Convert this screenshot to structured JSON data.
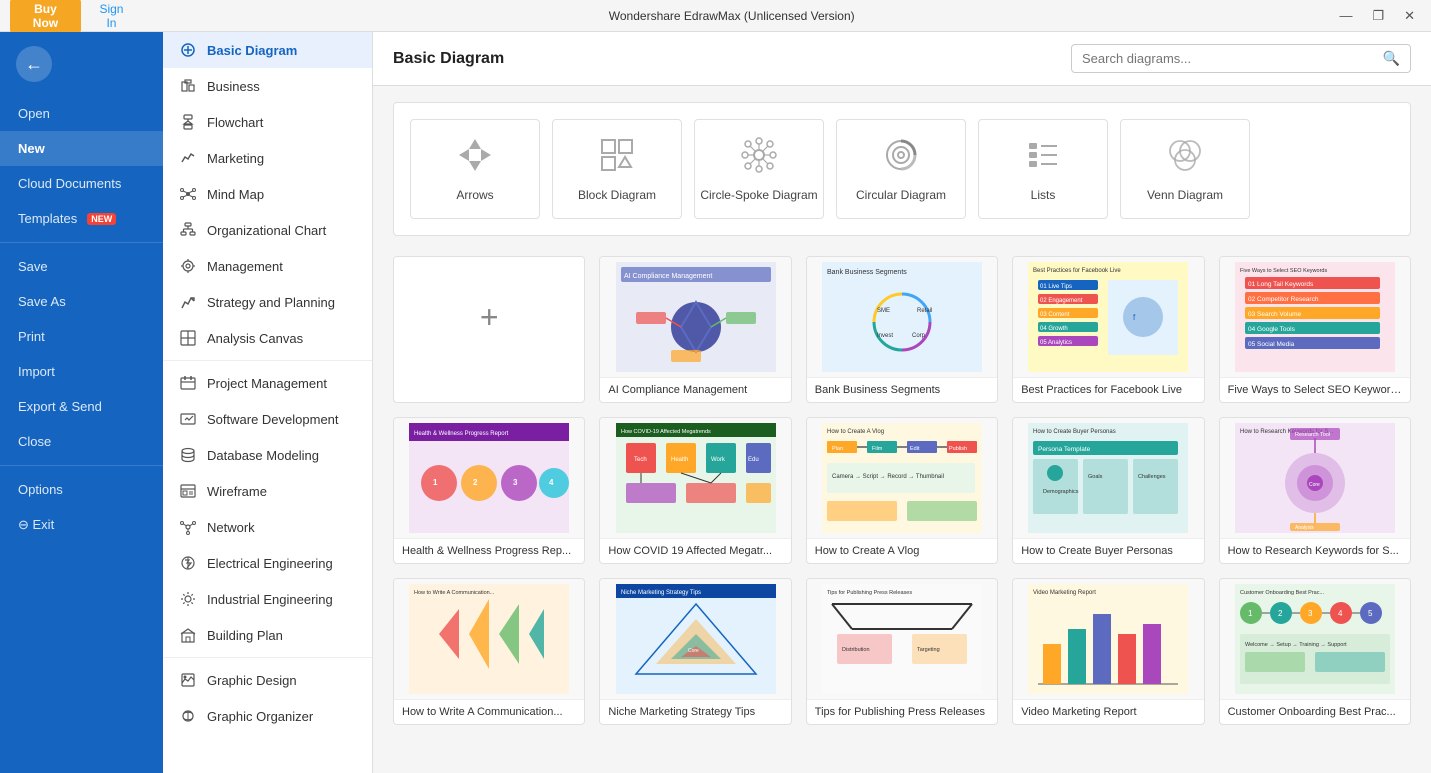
{
  "titlebar": {
    "title": "Wondershare EdrawMax (Unlicensed Version)",
    "buy_label": "Buy Now",
    "signin_label": "Sign In",
    "min": "—",
    "max": "❐",
    "close": "✕"
  },
  "sidebar": {
    "logo_icon": "←",
    "items": [
      {
        "id": "open",
        "label": "Open"
      },
      {
        "id": "new",
        "label": "New",
        "active": true
      },
      {
        "id": "cloud",
        "label": "Cloud Documents"
      },
      {
        "id": "templates",
        "label": "Templates",
        "badge": "NEW"
      },
      {
        "id": "save",
        "label": "Save"
      },
      {
        "id": "save-as",
        "label": "Save As"
      },
      {
        "id": "print",
        "label": "Print"
      },
      {
        "id": "import",
        "label": "Import"
      },
      {
        "id": "export",
        "label": "Export & Send"
      },
      {
        "id": "close",
        "label": "Close"
      },
      {
        "id": "options",
        "label": "Options"
      },
      {
        "id": "exit",
        "label": "⊖ Exit"
      }
    ]
  },
  "category_sidebar": {
    "title": "Basic Diagram",
    "items": [
      {
        "id": "basic",
        "label": "Basic Diagram",
        "active": true,
        "icon": "◉"
      },
      {
        "id": "business",
        "label": "Business",
        "icon": "⊞"
      },
      {
        "id": "flowchart",
        "label": "Flowchart",
        "icon": "⬡"
      },
      {
        "id": "marketing",
        "label": "Marketing",
        "icon": "📊"
      },
      {
        "id": "mindmap",
        "label": "Mind Map",
        "icon": "✦"
      },
      {
        "id": "orgchart",
        "label": "Organizational Chart",
        "icon": "⊕"
      },
      {
        "id": "management",
        "label": "Management",
        "icon": "⚙"
      },
      {
        "id": "strategy",
        "label": "Strategy and Planning",
        "icon": "📈"
      },
      {
        "id": "analysis",
        "label": "Analysis Canvas",
        "icon": "⊡"
      },
      {
        "id": "project",
        "label": "Project Management",
        "icon": "▦"
      },
      {
        "id": "software",
        "label": "Software Development",
        "icon": "⊞"
      },
      {
        "id": "database",
        "label": "Database Modeling",
        "icon": "⬡"
      },
      {
        "id": "wireframe",
        "label": "Wireframe",
        "icon": "▢"
      },
      {
        "id": "network",
        "label": "Network",
        "icon": "⊡"
      },
      {
        "id": "electrical",
        "label": "Electrical Engineering",
        "icon": "⊗"
      },
      {
        "id": "industrial",
        "label": "Industrial Engineering",
        "icon": "⚙"
      },
      {
        "id": "building",
        "label": "Building Plan",
        "icon": "⊞"
      },
      {
        "id": "graphic",
        "label": "Graphic Design",
        "icon": "▢"
      },
      {
        "id": "organizer",
        "label": "Graphic Organizer",
        "icon": "⊗"
      }
    ]
  },
  "search": {
    "placeholder": "Search diagrams..."
  },
  "diagram_types": [
    {
      "id": "arrows",
      "label": "Arrows",
      "icon": "arrows"
    },
    {
      "id": "block",
      "label": "Block Diagram",
      "icon": "block"
    },
    {
      "id": "circle-spoke",
      "label": "Circle-Spoke Diagram",
      "icon": "circle-spoke"
    },
    {
      "id": "circular",
      "label": "Circular Diagram",
      "icon": "circular"
    },
    {
      "id": "lists",
      "label": "Lists",
      "icon": "lists"
    },
    {
      "id": "venn",
      "label": "Venn Diagram",
      "icon": "venn"
    }
  ],
  "templates": [
    {
      "id": "new",
      "label": "",
      "type": "new"
    },
    {
      "id": "ai-compliance",
      "label": "AI Compliance Management",
      "colors": [
        "#5c6bc0",
        "#ef5350",
        "#66bb6a",
        "#ffa726"
      ]
    },
    {
      "id": "bank-business",
      "label": "Bank Business Segments",
      "colors": [
        "#42a5f5",
        "#ab47bc",
        "#26a69a",
        "#ffca28"
      ]
    },
    {
      "id": "facebook-live",
      "label": "Best Practices for Facebook Live",
      "colors": [
        "#1565c0",
        "#ef5350",
        "#ffa726"
      ]
    },
    {
      "id": "seo-keywords",
      "label": "Five Ways to Select SEO Keywords",
      "colors": [
        "#ef5350",
        "#ff7043",
        "#ffa726",
        "#26a69a",
        "#5c6bc0"
      ]
    },
    {
      "id": "health-wellness",
      "label": "Health & Wellness Progress Rep...",
      "colors": [
        "#ab47bc",
        "#ef5350",
        "#ffa726",
        "#26c6da"
      ]
    },
    {
      "id": "covid",
      "label": "How COVID 19 Affected Megatr...",
      "colors": [
        "#ef5350",
        "#ffa726",
        "#26a69a",
        "#5c6bc0",
        "#ab47bc"
      ]
    },
    {
      "id": "vlog",
      "label": "How to Create A Vlog",
      "colors": [
        "#ffa726",
        "#26a69a",
        "#5c6bc0",
        "#ef5350",
        "#66bb6a"
      ]
    },
    {
      "id": "buyer-personas",
      "label": "How to Create Buyer Personas",
      "colors": [
        "#26a69a",
        "#ffa726",
        "#5c6bc0",
        "#ef5350"
      ]
    },
    {
      "id": "keywords-research",
      "label": "How to Research Keywords for S...",
      "colors": [
        "#ab47bc",
        "#ffa726",
        "#26a69a"
      ]
    },
    {
      "id": "communications",
      "label": "How to Write A Communication...",
      "colors": [
        "#ef5350",
        "#ffa726",
        "#66bb6a"
      ]
    },
    {
      "id": "niche-marketing",
      "label": "Niche Marketing Strategy Tips",
      "colors": [
        "#1565c0",
        "#ffa726",
        "#26a69a",
        "#ef5350"
      ]
    },
    {
      "id": "press-releases",
      "label": "Tips for Publishing Press Releases",
      "colors": [
        "#333",
        "#666",
        "#ef5350",
        "#ffa726"
      ]
    },
    {
      "id": "video-marketing",
      "label": "Video Marketing Report",
      "colors": [
        "#ffa726",
        "#26a69a",
        "#5c6bc0",
        "#ef5350",
        "#ab47bc"
      ]
    },
    {
      "id": "customer-onboarding",
      "label": "Customer Onboarding Best Prac...",
      "colors": [
        "#66bb6a",
        "#26a69a",
        "#ffa726",
        "#ef5350"
      ]
    }
  ]
}
